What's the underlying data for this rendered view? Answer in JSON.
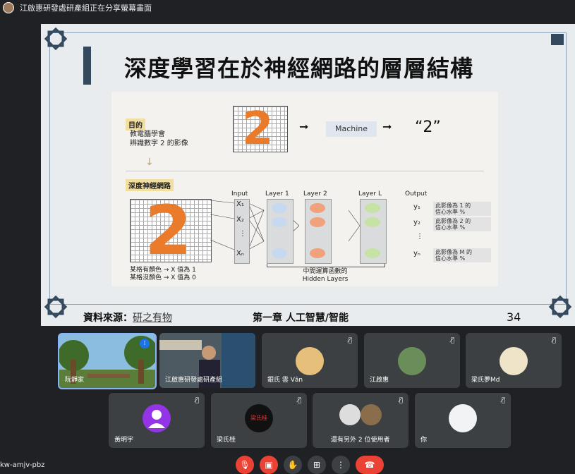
{
  "top_bar": {
    "text": "江啟惠研發處研產組正在分享螢幕畫面"
  },
  "slide": {
    "title": "深度學習在於神經網路的層層結構",
    "figure": {
      "goal_tag": "目的",
      "goal_text": "教電腦學會\n辨識數字 2 的影像",
      "machine": "Machine",
      "result": "“2”",
      "section_tag": "深度神經網路",
      "headers": {
        "input": "Input",
        "layer1": "Layer 1",
        "layer2": "Layer 2",
        "layerL": "Layer L",
        "output": "Output"
      },
      "inputs": [
        "X₁",
        "X₂",
        "⋮",
        "Xₙ"
      ],
      "outputs": [
        "y₁",
        "y₂",
        "⋮",
        "yₙ"
      ],
      "out_texts": [
        "此影像為 1 的\n信心水準 %",
        "此影像為 2 的\n信心水準 %",
        "此影像為 M 的\n信心水準 %"
      ],
      "caption": "某格有顏色 → X 值為 1\n某格沒顏色 → X 值為 0",
      "hidden": "中間運算函數的\nHidden Layers",
      "digit": "2"
    },
    "source_label": "資料來源：",
    "source_value": "研之有物",
    "chapter": "第一章  人工智慧/智能",
    "page": "34"
  },
  "participants": [
    {
      "name": "阮靜家",
      "muted": false
    },
    {
      "name": "江啟惠研發處研產組",
      "muted": false
    },
    {
      "name": "銀氏 雲 Văn",
      "muted": true
    },
    {
      "name": "江啟惠",
      "muted": true
    },
    {
      "name": "梁氏夢Md",
      "muted": true
    },
    {
      "name": "黃明宇",
      "muted": true
    },
    {
      "name": "梁氏桂",
      "muted": true
    },
    {
      "name": "還有另外 2 位使用者",
      "muted": true
    },
    {
      "name": "你",
      "muted": true
    }
  ],
  "meeting_code": "kw-amjv-pbz",
  "colors": {
    "accent": "#8ab4f8",
    "end": "#ea4335",
    "tile": "#3c4043",
    "digit": "#e97b2a"
  }
}
